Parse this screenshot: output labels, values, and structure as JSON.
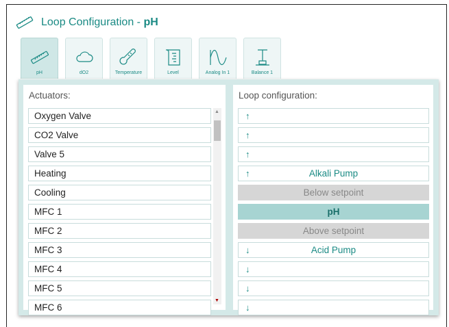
{
  "title": {
    "prefix": "Loop Configuration - ",
    "bold": "pH"
  },
  "tabs": [
    {
      "label": "pH",
      "icon": "ph-probe-icon",
      "active": true
    },
    {
      "label": "dO2",
      "icon": "cloud-icon",
      "active": false
    },
    {
      "label": "Temperature",
      "icon": "thermometer-icon",
      "active": false
    },
    {
      "label": "Level",
      "icon": "beaker-icon",
      "active": false
    },
    {
      "label": "Analog In 1",
      "icon": "waveform-icon",
      "active": false
    },
    {
      "label": "Balance 1",
      "icon": "balance-icon",
      "active": false
    }
  ],
  "actuators": {
    "header": "Actuators:",
    "items": [
      "Oxygen Valve",
      "CO2 Valve",
      "Valve 5",
      "Heating",
      "Cooling",
      "MFC 1",
      "MFC 2",
      "MFC 3",
      "MFC 4",
      "MFC 5",
      "MFC 6"
    ]
  },
  "loop": {
    "header": "Loop configuration:",
    "slots": [
      {
        "arrow": "↑",
        "label": "",
        "style": "normal"
      },
      {
        "arrow": "↑",
        "label": "",
        "style": "normal"
      },
      {
        "arrow": "↑",
        "label": "",
        "style": "normal"
      },
      {
        "arrow": "↑",
        "label": "Alkali Pump",
        "style": "normal"
      },
      {
        "arrow": "",
        "label": "Below setpoint",
        "style": "grey"
      },
      {
        "arrow": "",
        "label": "pH",
        "style": "ph"
      },
      {
        "arrow": "",
        "label": "Above setpoint",
        "style": "grey"
      },
      {
        "arrow": "↓",
        "label": "Acid Pump",
        "style": "normal"
      },
      {
        "arrow": "↓",
        "label": "",
        "style": "normal"
      },
      {
        "arrow": "↓",
        "label": "",
        "style": "normal"
      },
      {
        "arrow": "↓",
        "label": "",
        "style": "normal"
      }
    ]
  },
  "colors": {
    "accent": "#1a8a84",
    "panel": "#d4e9e8",
    "setpoint": "#a7d4d2"
  }
}
